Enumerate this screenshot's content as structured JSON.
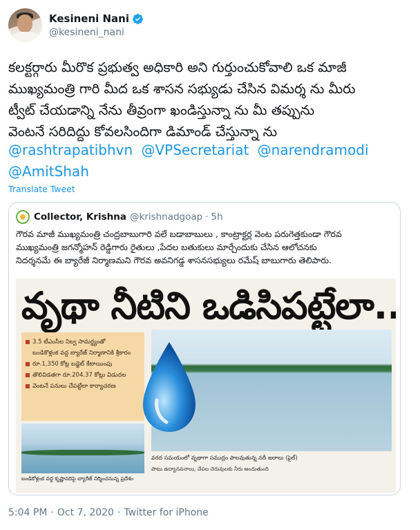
{
  "author": {
    "display_name": "Kesineni Nani",
    "handle": "@kesineni_nani",
    "verified_icon": "verified-badge-icon",
    "accent_color": "#1da1f2"
  },
  "tweet": {
    "lines": [
      "కలక్టర్గారు మీరొక ప్రభుత్వ అధికారి అని గుర్తుంచుకోవాలి ఒక మాజీ",
      "ముఖ్యమంత్రి గారి మీద ఒక శాసన సభ్యుడు చేసిన విమర్శ ను మీరు",
      "ట్వీట్ చేయడాన్ని నేను తీవ్రంగా ఖండిస్తున్నా ను మీ తప్పును",
      "వెంటనే సరిదిద్దు కోవలసిందిగా డిమాండ్ చేస్తున్నా ను"
    ],
    "mentions": [
      "@rashtrapatibhvn",
      "@VPSecretariat",
      "@narendramodi",
      "@AmitShah"
    ],
    "translate_label": "Translate Tweet",
    "link_color": "#1b95e0"
  },
  "quote": {
    "display_name": "Collector, Krishna",
    "handle": "@krishnadgoap",
    "separator": "·",
    "time": "5h",
    "lines": [
      "గౌరవ మాజీ ముఖ్యమంత్రి చంద్రబాబుగారి  వలే బడాబాబులు , కాంట్రాక్టర్ల వెంట పరుగెత్తకుండా గౌరవ",
      "ముఖ్యమంత్రి జగన్మోహన్ రెడ్డిగారు రైతులు ,పేదల బతుకులు మార్చేందుకు చేసిన ఆలోచనకు",
      "నిదర్శనమే ఈ బ్యారేజీ నిర్మాణమని గౌరవ అవనిగడ్డ శాసనసభ్యులు రమేష్ బాబుగారు తెలిపారు."
    ],
    "clipping": {
      "headline": "వృథా నీటిని ఒడిసిపట్టేలా..",
      "bullets": [
        "3.5 టీఎంసీల నిల్వ సామర్థ్యంతో",
        "బండికొళ్లంక వద్ద బ్యారేజ్ నిర్మాణానికి శ్రీకారం",
        "రూ.1,350 కోట్ల బడ్జెట్ కేటాయింపు",
        "తొలివిడతగా రూ.204.37 కోట్లు విడుదల",
        "వెంటనే పనులు చేపట్టేలా కార్యాచరణ"
      ],
      "caption_left": "బండికోళ్లంక వద్ద కృష్ణానదిపై బ్యారేజ్ నిర్మించనున్న ప్రదేశం",
      "caption_right": "వరద సమయంలో వృథాగా సముద్రం పాలవుతున్న నదీ జలాలు (ఫైల్)",
      "body_line": "పాటు ఉద్యానవనాలు, చేపల చెరువులకు నీరు అందుతుంది"
    }
  },
  "meta": {
    "time": "5:04 PM",
    "separator": "·",
    "date": "Oct 7, 2020",
    "source": "Twitter for iPhone"
  }
}
